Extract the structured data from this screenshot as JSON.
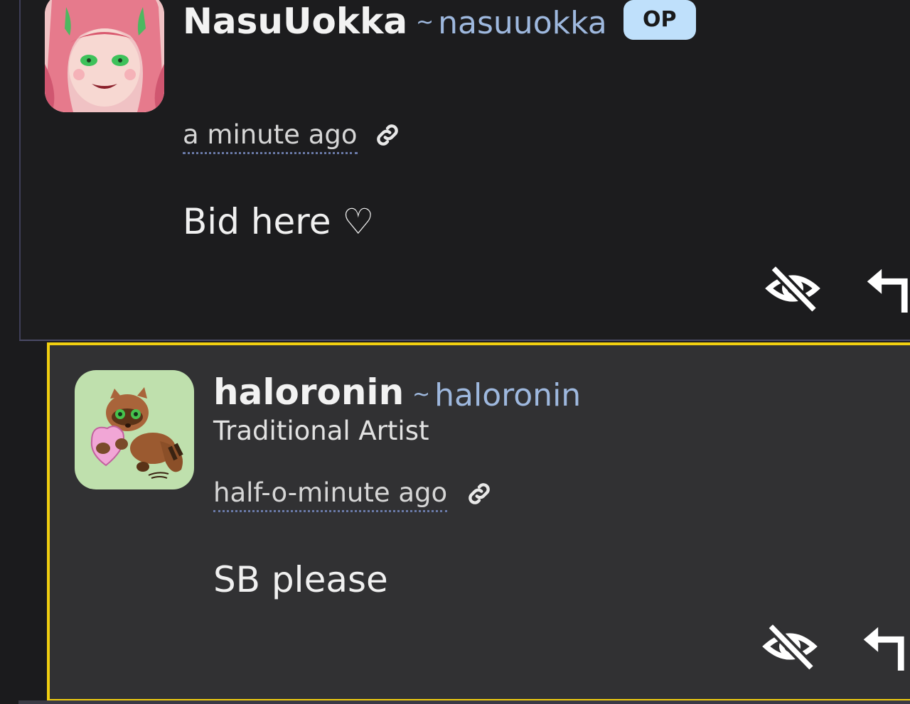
{
  "comments": [
    {
      "display_name": "NasuUokka",
      "username": "nasuuokka",
      "tilde": "~",
      "badge": "OP",
      "timestamp": "a minute ago",
      "body": "Bid here ♡",
      "avatar_icon": "pink-haired-character-avatar",
      "highlighted": false
    },
    {
      "display_name": "haloronin",
      "username": "haloronin",
      "tilde": "~",
      "user_title": "Traditional Artist",
      "timestamp": "half-o-minute ago",
      "body": "SB please",
      "avatar_icon": "raccoon-with-heart-avatar",
      "highlighted": true
    }
  ],
  "colors": {
    "highlight_border": "#f1cf10",
    "username": "#9eb8de",
    "badge_bg": "#bfe0fb"
  }
}
